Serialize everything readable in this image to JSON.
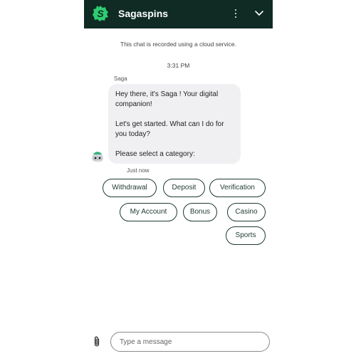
{
  "header": {
    "brand": "Sagaspins",
    "accent_color": "#0f2b23",
    "logo_color": "#2ecc71",
    "icons": [
      "sagaspins-logo-icon",
      "more-vertical-icon",
      "chevron-down-icon"
    ]
  },
  "conversation": {
    "notice": "This chat is recorded using a cloud service.",
    "timestamp": "3:31 PM",
    "sender": "Saga",
    "message": {
      "line1": "Hey there, it's Saga ! Your digital companion!",
      "line2": "Let's get started. What can I do for you today?",
      "line3": "Please select a category:"
    },
    "status": "Just now"
  },
  "categories": [
    {
      "label": "Withdrawal"
    },
    {
      "label": "Deposit"
    },
    {
      "label": "Verification"
    },
    {
      "label": "My Account"
    },
    {
      "label": "Bonus"
    },
    {
      "label": "Casino"
    },
    {
      "label": "Sports"
    }
  ],
  "composer": {
    "placeholder": "Type a message",
    "attach_icon": "paperclip-icon"
  }
}
